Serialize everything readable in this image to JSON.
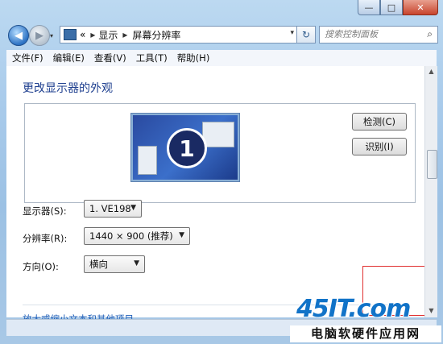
{
  "window": {
    "caption_min": "—",
    "caption_max": "□",
    "caption_close": "✕"
  },
  "nav": {
    "back_glyph": "◀",
    "forward_glyph": "▶",
    "recent_glyph": "▾",
    "breadcrumb_lead": "«",
    "breadcrumb": [
      "显示",
      "屏幕分辨率"
    ],
    "breadcrumb_sep": "▸",
    "refresh_glyph": "↻",
    "search_placeholder": "搜索控制面板"
  },
  "menu": [
    "文件(F)",
    "编辑(E)",
    "查看(V)",
    "工具(T)",
    "帮助(H)"
  ],
  "page": {
    "title": "更改显示器的外观",
    "monitor_number": "1",
    "detect_button": "检测(C)",
    "identify_button": "识别(I)",
    "display_label": "显示器(S):",
    "display_value": "1. VE198",
    "resolution_label": "分辨率(R):",
    "resolution_value": "1440 × 900 (推荐)",
    "orientation_label": "方向(O):",
    "orientation_value": "横向",
    "bottom_link": "放大或缩小文本和其他项目"
  },
  "watermark": {
    "brand": "45IT.com",
    "subtitle": "电脑软硬件应用网"
  },
  "colors": {
    "title_blue": "#1e3f8f",
    "link_blue": "#1f5fb8",
    "highlight_red": "#e03030"
  },
  "icons": {
    "search": "search-icon",
    "refresh": "refresh-icon",
    "location": "control-panel-icon"
  }
}
